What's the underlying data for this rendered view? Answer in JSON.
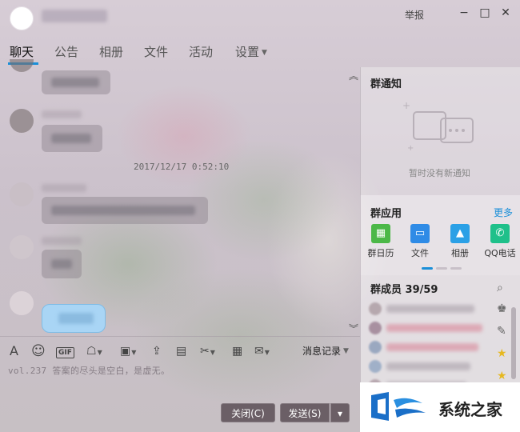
{
  "window": {
    "report": "举报",
    "minimize": "−",
    "maximize": "□",
    "close": "✕"
  },
  "tabs": [
    {
      "label": "聊天"
    },
    {
      "label": "公告"
    },
    {
      "label": "相册"
    },
    {
      "label": "文件"
    },
    {
      "label": "活动"
    },
    {
      "label": "设置"
    }
  ],
  "chat": {
    "timestamp": "2017/12/17 0:52:10"
  },
  "toolbar": {
    "font": "A",
    "emoji": "☺",
    "gif": "GIF",
    "message_record": "消息记录"
  },
  "input": {
    "text": "vol.237 答案的尽头是空白，是虚无。"
  },
  "buttons": {
    "close": "关闭(C)",
    "send": "发送(S)",
    "send_menu": "▾"
  },
  "right_panel": {
    "notice_title": "群通知",
    "notice_empty": "暂时没有新通知",
    "apps_title": "群应用",
    "more": "更多",
    "apps": [
      {
        "label": "群日历",
        "color": "#4cb848",
        "icon": "calendar-icon"
      },
      {
        "label": "文件",
        "color": "#2f8be6",
        "icon": "folder-icon"
      },
      {
        "label": "相册",
        "color": "#2ba0e6",
        "icon": "image-icon"
      },
      {
        "label": "QQ电话",
        "color": "#1fc08a",
        "icon": "phone-icon"
      }
    ],
    "members_title": "群成员 39/59"
  },
  "watermark": {
    "text": "系统之家"
  }
}
